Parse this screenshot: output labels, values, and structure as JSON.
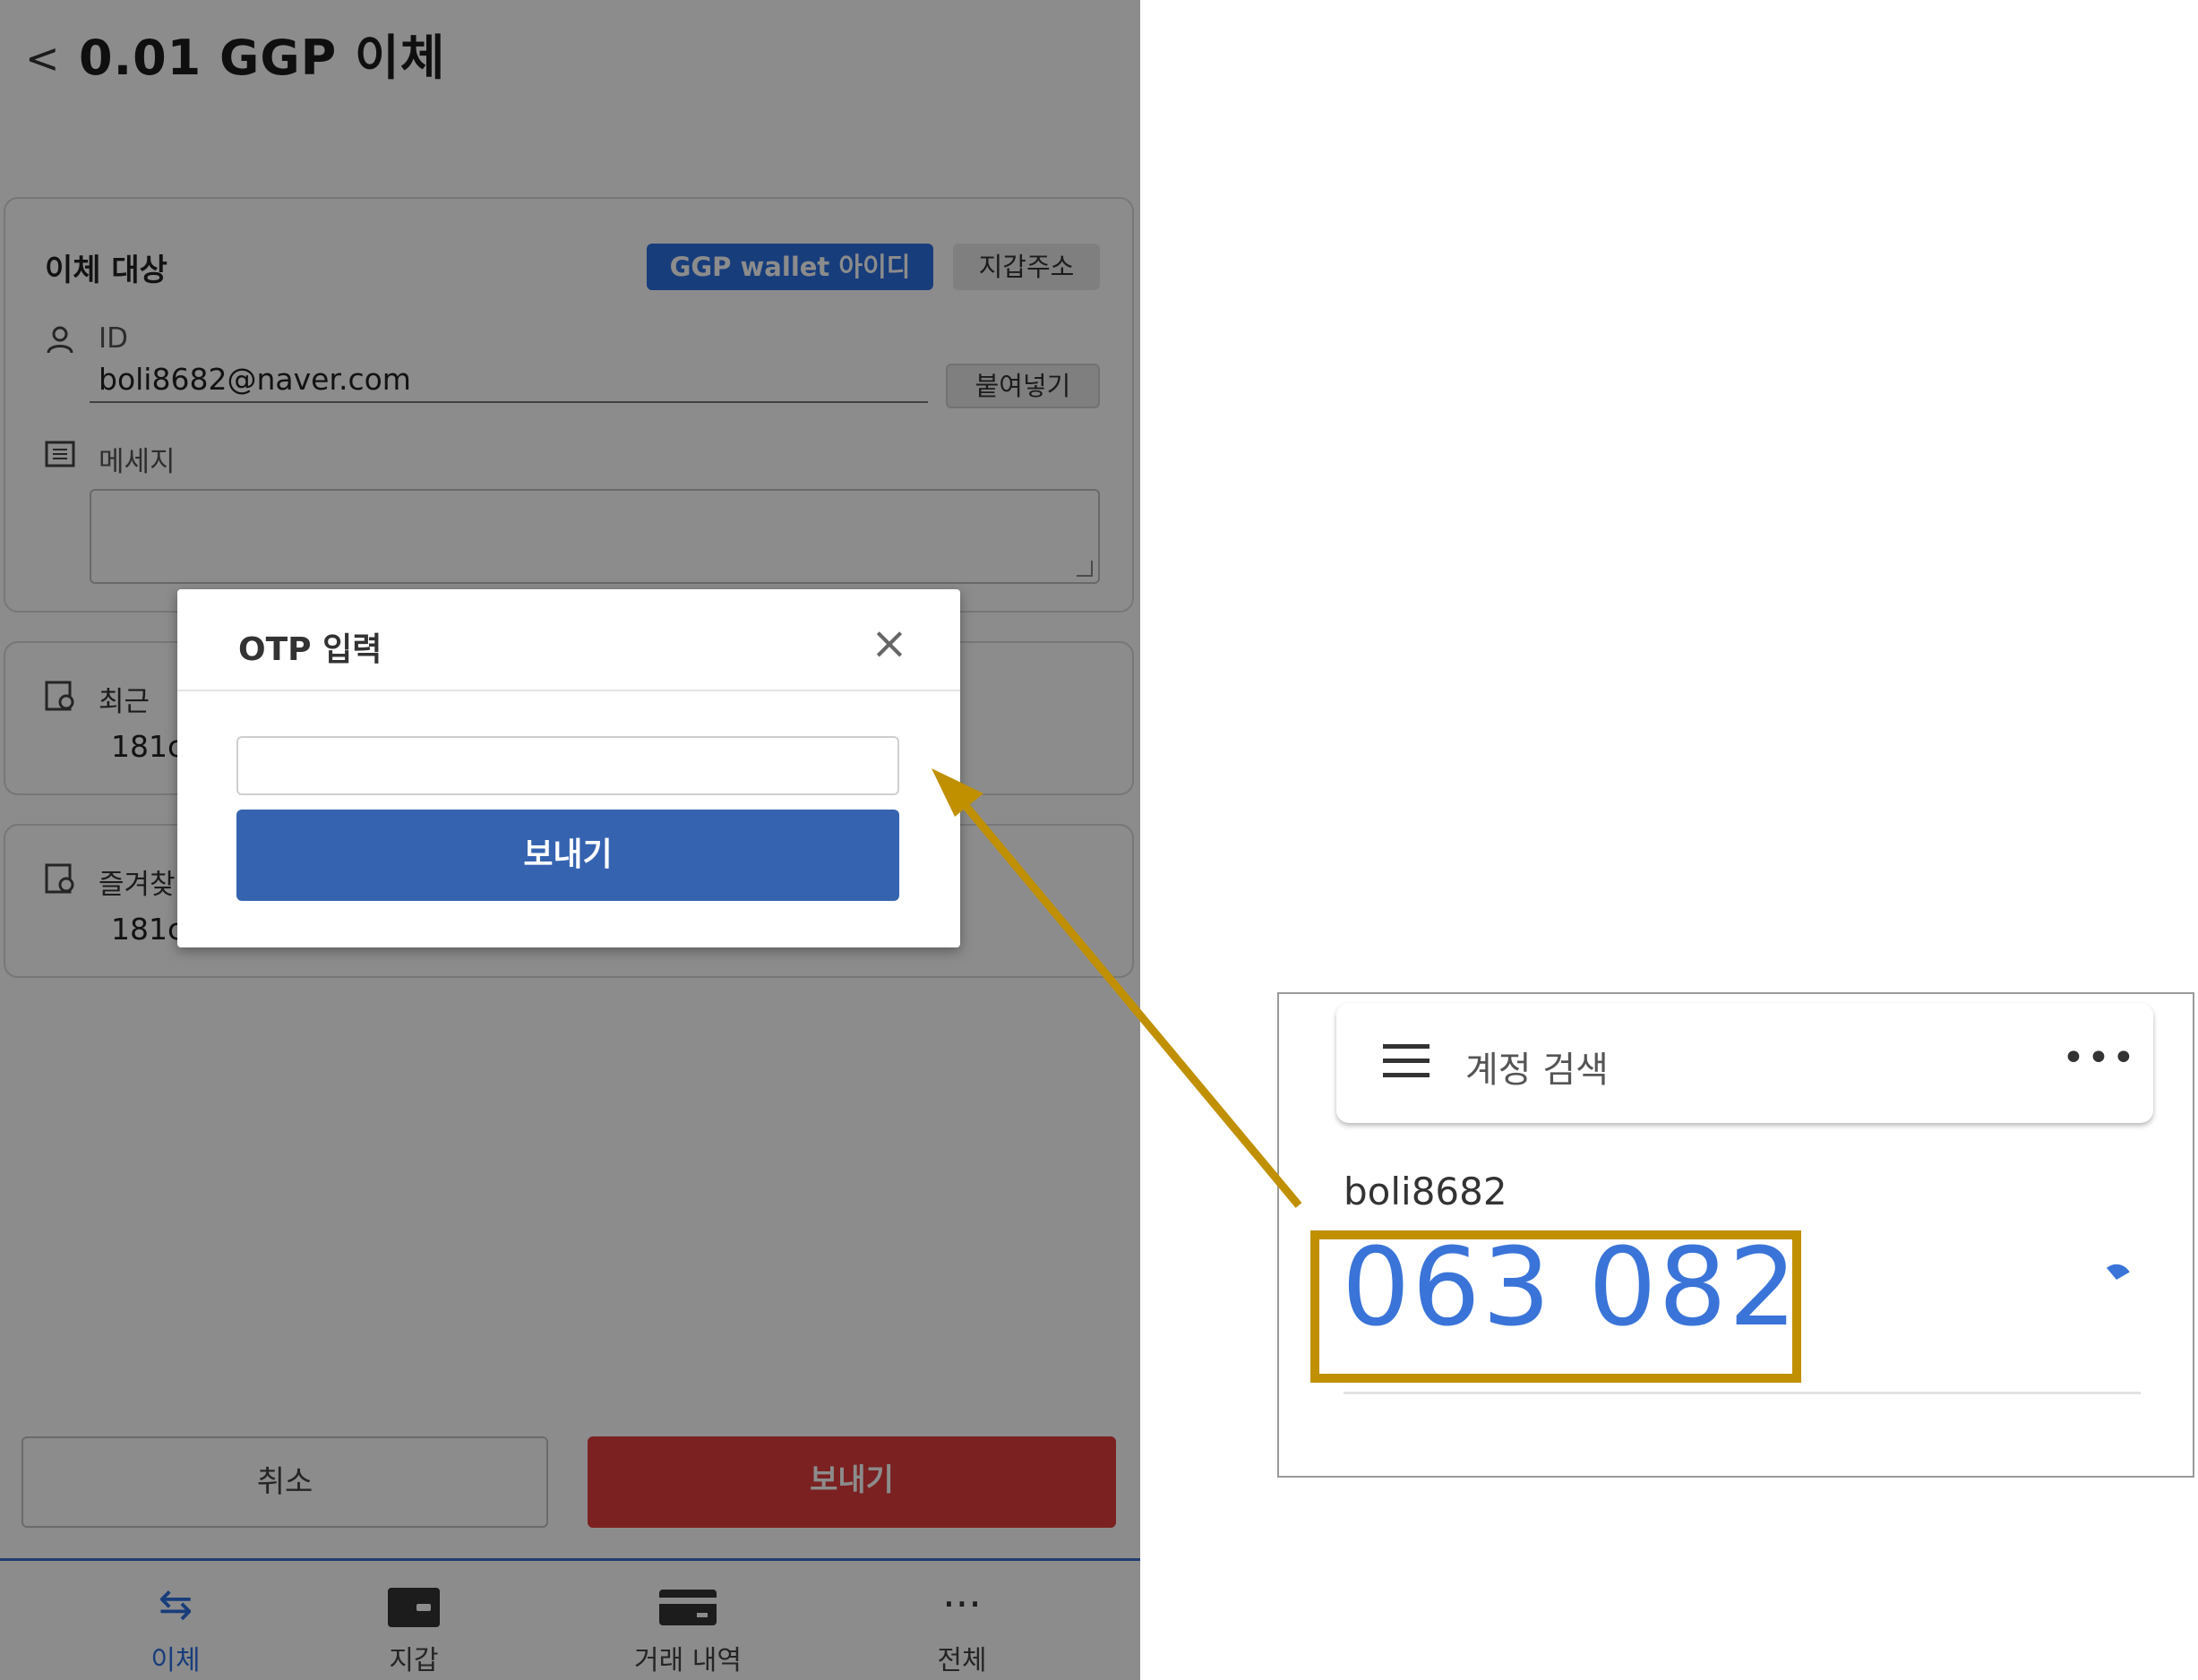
{
  "app": {
    "title": "0.01 GGP 이체",
    "back_icon": "chevron-left-icon",
    "target_card": {
      "title": "이체 대상",
      "tabs": [
        "GGP wallet 아이디",
        "지갑주소"
      ],
      "id_label": "ID",
      "id_value": "boli8682@naver.com",
      "paste_label": "붙여넣기",
      "message_label": "메세지",
      "message_value": ""
    },
    "recent": {
      "label": "최근",
      "value": "181c"
    },
    "favorites": {
      "label": "즐겨찾",
      "value": "181c"
    },
    "cancel_label": "취소",
    "send_label": "보내기",
    "nav": [
      {
        "label": "이체",
        "icon": "transfer-arrows-icon",
        "active": true
      },
      {
        "label": "지갑",
        "icon": "wallet-icon",
        "active": false
      },
      {
        "label": "거래 내역",
        "icon": "card-icon",
        "active": false
      },
      {
        "label": "전체",
        "icon": "more-icon",
        "active": false
      }
    ]
  },
  "otp_modal": {
    "title": "OTP 입력",
    "input_value": "",
    "submit_label": "보내기"
  },
  "authenticator": {
    "search_placeholder": "계정 검색",
    "account": "boli8682",
    "code": "063 082"
  },
  "colors": {
    "accent_blue": "#2d6fe0",
    "send_red": "#e03c3c",
    "modal_button": "#3563b0",
    "highlight": "#c09000",
    "otp_code": "#3a74d8"
  }
}
